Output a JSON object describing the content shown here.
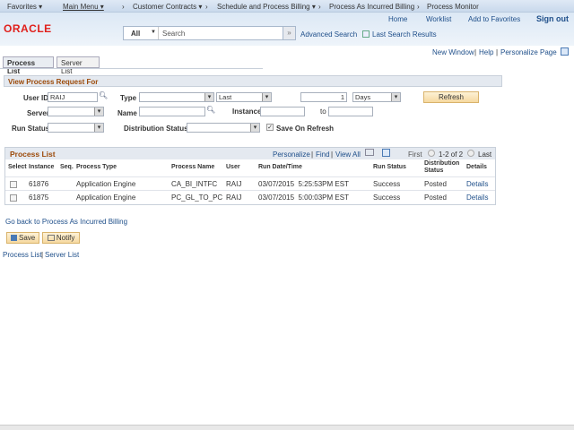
{
  "nav": {
    "items": [
      "Favorites ▾",
      "Main Menu ▾",
      "›",
      "Customer Contracts ▾",
      "›",
      "Schedule and Process Billing ▾",
      "›",
      "Process As Incurred Billing",
      "›",
      "Process Monitor"
    ]
  },
  "header": {
    "logo": "ORACLE",
    "links": [
      "Home",
      "Worklist",
      "Add to Favorites",
      "Sign out"
    ],
    "search_scope": "All",
    "search_placeholder": "Search",
    "advanced_search": "Advanced Search",
    "last_results": "Last Search Results"
  },
  "toplinks": {
    "new_window": "New Window",
    "help": "Help",
    "personalize": "Personalize Page"
  },
  "tabs": [
    "Process List",
    "Server List"
  ],
  "filter": {
    "title": "View Process Request For",
    "user_id_label": "User ID",
    "user_id": "RAIJ",
    "type_label": "Type",
    "type": "",
    "last": "Last",
    "count": "1",
    "unit": "Days",
    "refresh": "Refresh",
    "server_label": "Server",
    "name_label": "Name",
    "instance_label": "Instance",
    "to_label": "to",
    "run_status_label": "Run Status",
    "dist_status_label": "Distribution Status",
    "save_on_refresh": "Save On Refresh",
    "save_on_refresh_checked": true
  },
  "process_list": {
    "title": "Process List",
    "personalize": "Personalize",
    "find": "Find",
    "view_all": "View All",
    "first": "First",
    "range": "1-2 of 2",
    "last": "Last",
    "columns": [
      "Select",
      "Instance",
      "Seq.",
      "Process Type",
      "Process Name",
      "User",
      "Run Date/Time",
      "Run Status",
      "Distribution Status",
      "Details"
    ],
    "rows": [
      {
        "instance": "61876",
        "seq": "",
        "type": "Application Engine",
        "name": "CA_BI_INTFC",
        "user": "RAIJ",
        "datetime": "03/07/2015  5:25:53PM EST",
        "status": "Success",
        "dist": "Posted",
        "details": "Details"
      },
      {
        "instance": "61875",
        "seq": "",
        "type": "Application Engine",
        "name": "PC_GL_TO_PC",
        "user": "RAIJ",
        "datetime": "03/07/2015  5:00:03PM EST",
        "status": "Success",
        "dist": "Posted",
        "details": "Details"
      }
    ]
  },
  "go_back": "Go back to Process As Incurred Billing",
  "buttons": {
    "save": "Save",
    "notify": "Notify"
  },
  "footer": {
    "process_list": "Process List",
    "sep": "|",
    "server_list": "Server List"
  }
}
